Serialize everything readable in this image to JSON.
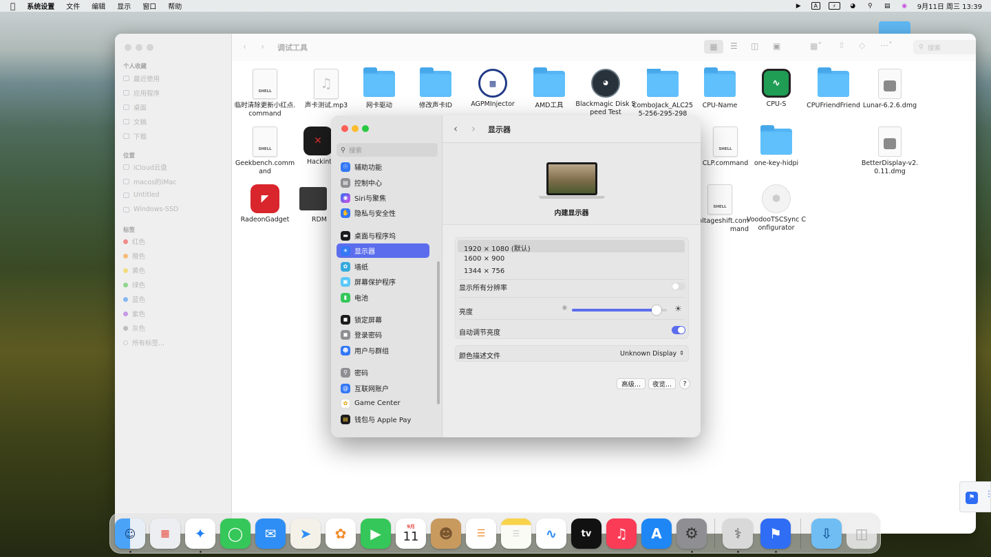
{
  "menubar": {
    "app": "系统设置",
    "items": [
      "文件",
      "编辑",
      "显示",
      "窗口",
      "帮助"
    ],
    "datetime": "9月11日 周三 13:39",
    "input_label": "A"
  },
  "finder": {
    "title": "调试工具",
    "search_placeholder": "搜索",
    "sections": {
      "favorites": "个人收藏",
      "locations": "位置",
      "tags": "标签"
    },
    "favorites": [
      "最近使用",
      "应用程序",
      "桌面",
      "文稿",
      "下载"
    ],
    "locations": [
      "iCloud云盘",
      "macos的iMac",
      "Untitled",
      "Windows-SSD"
    ],
    "tags": [
      {
        "label": "红色",
        "color": "#f08c8c"
      },
      {
        "label": "橙色",
        "color": "#f5bd7a"
      },
      {
        "label": "黄色",
        "color": "#f1dc7d"
      },
      {
        "label": "绿色",
        "color": "#8fd68f"
      },
      {
        "label": "蓝色",
        "color": "#85b8f0"
      },
      {
        "label": "紫色",
        "color": "#c59ae3"
      },
      {
        "label": "灰色",
        "color": "#bdbdbd"
      }
    ],
    "all_tags": "所有标签...",
    "files": [
      "临时清除更新小红点.command",
      "声卡测试.mp3",
      "网卡驱动",
      "修改声卡ID",
      "AGPMInjector",
      "AMD工具",
      "Blackmagic Disk Speed Test",
      "ComboJack_ALC255-256-295-298",
      "CPU-Name",
      "CPU-S",
      "CPUFriendFriend",
      "Lunar-6.2.6.dmg",
      "Geekbench.command",
      "Hackintool",
      "CLP.command",
      "one-key-hidpi",
      "BetterDisplay-v2.0.11.dmg",
      "RadeonGadget",
      "RDM",
      "voltageshift.command",
      "VoodooTSCSync Configurator"
    ],
    "shell_badge": "SHELL"
  },
  "settings": {
    "search_placeholder": "搜索",
    "title": "显示器",
    "display_name": "内建显示器",
    "sidebar": [
      {
        "label": "辅助功能",
        "icon": "accessibility-icon",
        "color": "#3478f6"
      },
      {
        "label": "控制中心",
        "icon": "control-center-icon",
        "color": "#8e8e93"
      },
      {
        "label": "Siri与聚焦",
        "icon": "siri-icon",
        "color": "#c74ce0"
      },
      {
        "label": "隐私与安全性",
        "icon": "privacy-hand-icon",
        "color": "#3478f6"
      },
      {
        "label": "桌面与程序坞",
        "icon": "dock-icon",
        "color": "#1c1c1e"
      },
      {
        "label": "显示器",
        "icon": "display-sun-icon",
        "color": "#3478f6"
      },
      {
        "label": "墙纸",
        "icon": "wallpaper-icon",
        "color": "#34aadc"
      },
      {
        "label": "屏幕保护程序",
        "icon": "screensaver-icon",
        "color": "#5ac8fa"
      },
      {
        "label": "电池",
        "icon": "battery-icon",
        "color": "#34c759"
      },
      {
        "label": "锁定屏幕",
        "icon": "lock-screen-icon",
        "color": "#1c1c1e"
      },
      {
        "label": "登录密码",
        "icon": "lock-icon",
        "color": "#8e8e93"
      },
      {
        "label": "用户与群组",
        "icon": "users-icon",
        "color": "#3478f6"
      },
      {
        "label": "密码",
        "icon": "key-icon",
        "color": "#8e8e93"
      },
      {
        "label": "互联网账户",
        "icon": "at-icon",
        "color": "#3478f6"
      },
      {
        "label": "Game Center",
        "icon": "game-center-icon",
        "color": "#ffffff"
      },
      {
        "label": "钱包与 Apple Pay",
        "icon": "wallet-icon",
        "color": "#1c1c1e"
      }
    ],
    "resolutions": [
      "1920 × 1080 (默认)",
      "1600 × 900",
      "1344 × 756"
    ],
    "show_all": "显示所有分辨率",
    "show_all_on": false,
    "brightness_label": "亮度",
    "brightness": 0.89,
    "auto_brightness_label": "自动调节亮度",
    "auto_brightness_on": true,
    "color_profile_label": "颜色描述文件",
    "color_profile_value": "Unknown Display",
    "advanced_btn": "高级...",
    "night_shift_btn": "夜览...",
    "help_btn": "?"
  },
  "dock": {
    "calendar_month": "9月",
    "calendar_day": "11",
    "tv_label": "tv"
  }
}
